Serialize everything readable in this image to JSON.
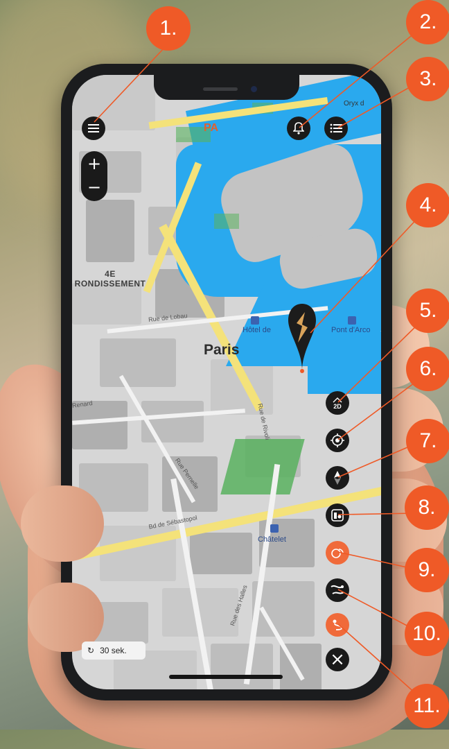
{
  "map": {
    "city_label": "Paris",
    "district_line1": "4E",
    "district_line2": "RONDISSEMENT",
    "brand_label": "PA",
    "corner_label": "Oryx d",
    "pois": [
      {
        "label": "Hôtel de"
      },
      {
        "label": "Pont d'Arco"
      },
      {
        "label": "Châtelet"
      }
    ],
    "streets": [
      {
        "label": "Bd de Sébastopol"
      },
      {
        "label": "Rue de Rivoli"
      },
      {
        "label": "Rue Pernelle"
      },
      {
        "label": "Rue des Halles"
      },
      {
        "label": "Rue de Lobau"
      },
      {
        "label": "Renard"
      }
    ]
  },
  "controls": {
    "zoom_in": "+",
    "zoom_out": "−",
    "view_mode_label": "2D",
    "close": "×"
  },
  "timer": {
    "value": "30 sek."
  },
  "callouts": [
    "1.",
    "2.",
    "3.",
    "4.",
    "5.",
    "6.",
    "7.",
    "8.",
    "9.",
    "10.",
    "11."
  ],
  "colors": {
    "accent": "#ef5a27",
    "water": "#2aa9ee",
    "button": "#1a1a1a",
    "road": "#f4e27a",
    "park": "#59b25f"
  }
}
